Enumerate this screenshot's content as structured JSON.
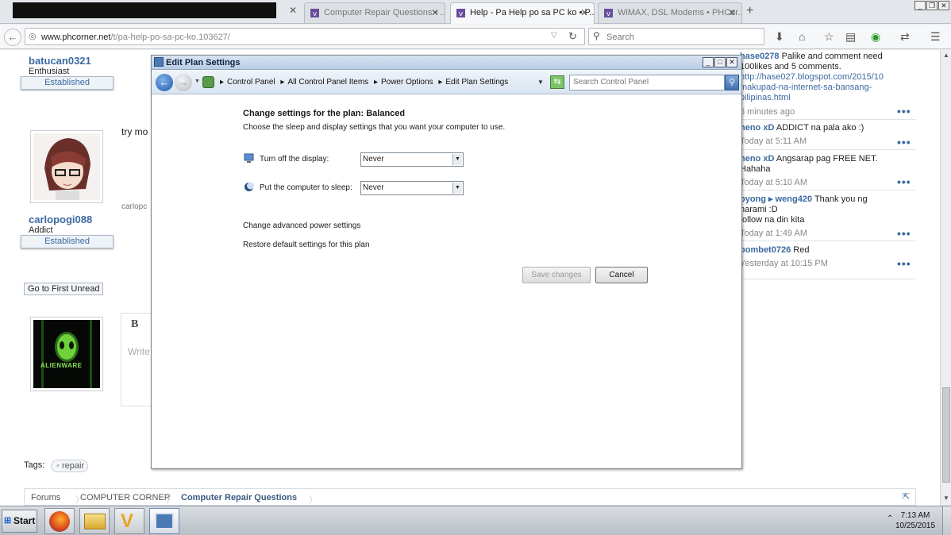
{
  "browser": {
    "tabs": [
      {
        "label": "Computer Repair Questions • ...",
        "active": false
      },
      {
        "label": "Help - Pa Help po sa PC ko • P...",
        "active": true
      },
      {
        "label": "WiMAX, DSL Modems • PHCor...",
        "active": false
      }
    ],
    "url_domain": "www.phcorner.net",
    "url_path": "/t/pa-help-po-sa-pc-ko.103627/",
    "search_placeholder": "Search"
  },
  "page": {
    "users": [
      {
        "name": "batucan0321",
        "role": "Enthusiast",
        "badge": "Established"
      },
      {
        "name": "carlopogi088",
        "role": "Addict",
        "badge": "Established"
      }
    ],
    "post_snippet": "try mo",
    "signature_snippet": "carlopc",
    "go_first_unread": "Go to First Unread",
    "editor_bold": "B",
    "editor_placeholder": "Write",
    "alienware_text": "ALIENWARE",
    "tags_label": "Tags:",
    "tag": "repair",
    "crumbs": [
      "Forums",
      "COMPUTER CORNER",
      "Computer Repair Questions"
    ],
    "sidebar": [
      {
        "name": "hase0278",
        "text": " Palike and comment need",
        "line2": "100likes and 5 comments.",
        "link": "http://hase027.blogspot.com/2015/10",
        "link2": "makupad-na-internet-sa-bansang-",
        "link3": "pilipinas.html",
        "time": "6 minutes ago"
      },
      {
        "name": "heno xD",
        "text": " ADDICT na pala ako :)",
        "time": "Today at 5:11 AM"
      },
      {
        "name": "heno xD",
        "text": " Angsarap pag FREE NET.",
        "line2": "Hahaha",
        "time": "Today at 5:10 AM"
      },
      {
        "name": "byong ▸ weng420",
        "text": " Thank you ng",
        "line2": "harami :D",
        "line3": "follow na din kita",
        "time": "Today at 1:49 AM"
      },
      {
        "name": "bombet0726",
        "text": " Red",
        "time": "Yesterday at 10:15 PM"
      }
    ],
    "more_dots": "•••"
  },
  "dialog": {
    "title": "Edit Plan Settings",
    "breadcrumbs": [
      "Control Panel",
      "All Control Panel Items",
      "Power Options",
      "Edit Plan Settings"
    ],
    "search_placeholder": "Search Control Panel",
    "heading": "Change settings for the plan: Balanced",
    "subheading": "Choose the sleep and display settings that you want your computer to use.",
    "display_label": "Turn off the display:",
    "display_value": "Never",
    "sleep_label": "Put the computer to sleep:",
    "sleep_value": "Never",
    "advanced_link": "Change advanced power settings",
    "restore_link": "Restore default settings for this plan",
    "save_label": "Save changes",
    "cancel_label": "Cancel"
  },
  "taskbar": {
    "start_label": "Start",
    "time": "7:13 AM",
    "date": "10/25/2015"
  }
}
